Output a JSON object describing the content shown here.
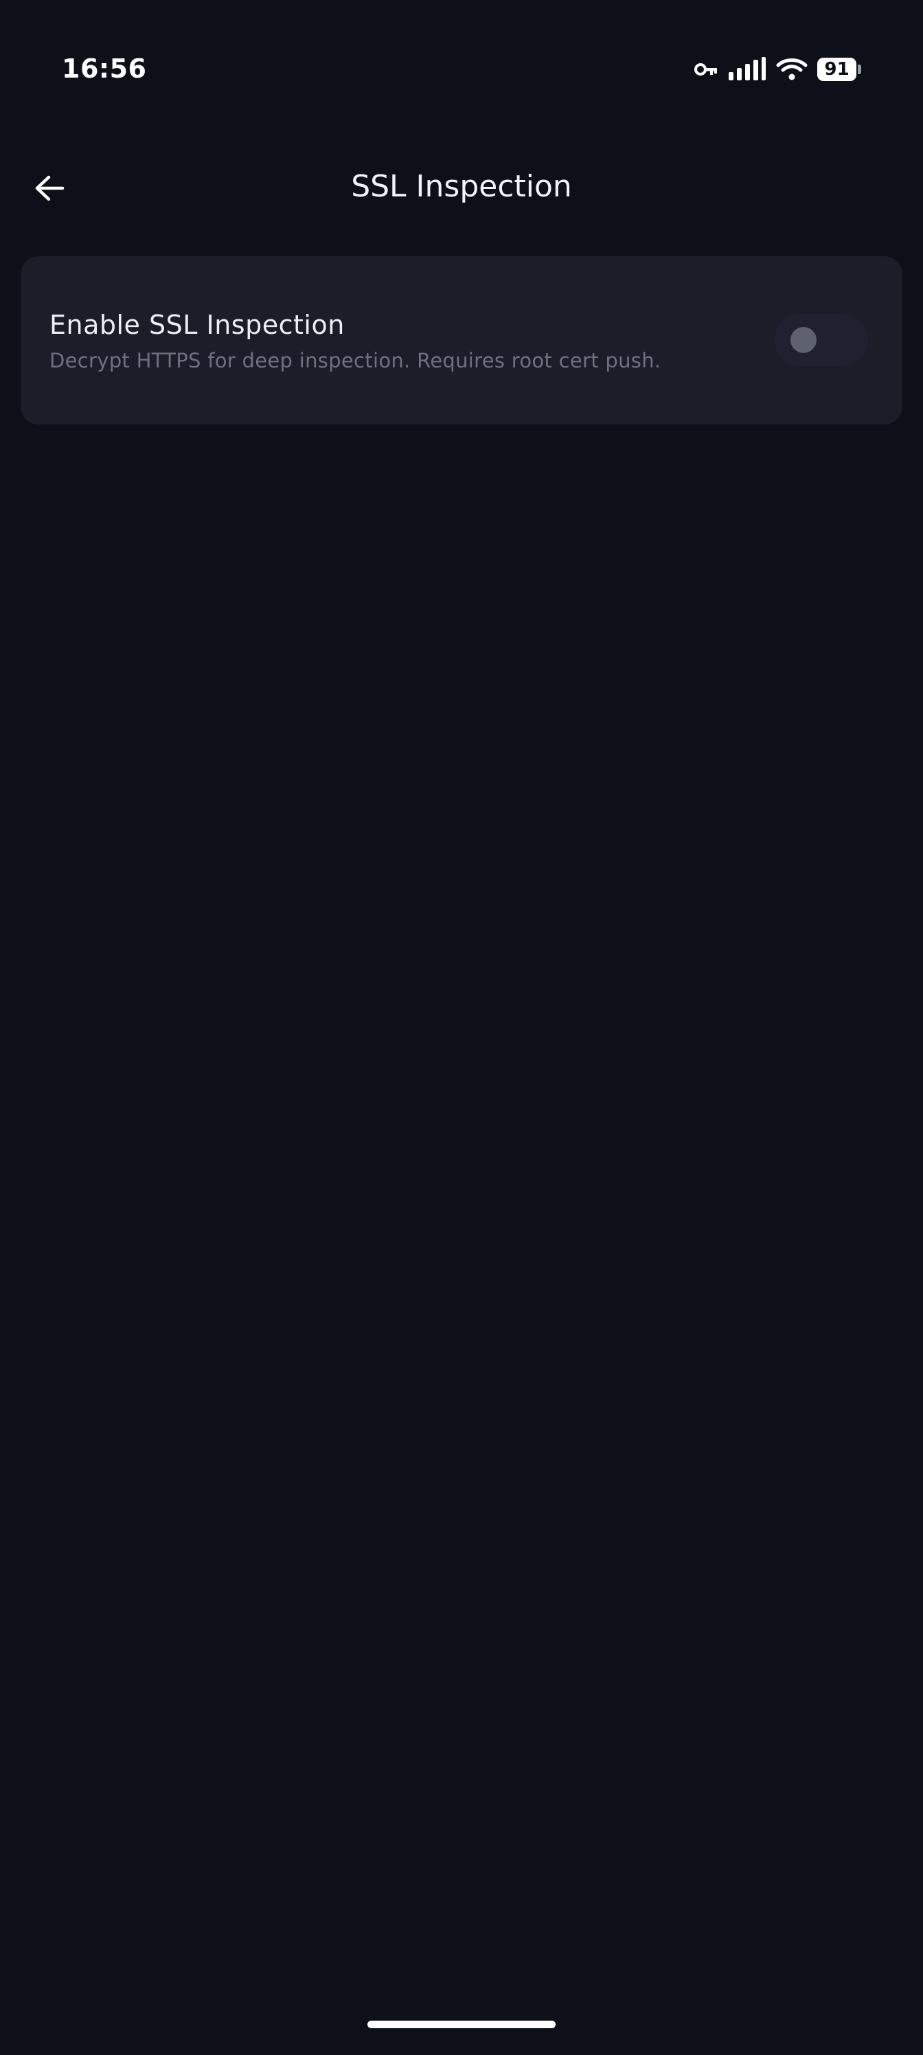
{
  "status_bar": {
    "time": "16:56",
    "battery_level": "91",
    "icons": [
      "vpn-key-icon",
      "signal-icon",
      "wifi-icon",
      "battery-icon"
    ]
  },
  "app_bar": {
    "title": "SSL Inspection",
    "back_icon": "arrow-left-icon"
  },
  "settings": {
    "ssl_inspection": {
      "title": "Enable SSL Inspection",
      "description": "Decrypt HTTPS for deep inspection. Requires root cert push.",
      "enabled": false
    }
  },
  "colors": {
    "background": "#0d1018",
    "card": "#1b1d29",
    "title_text": "#f2f3f7",
    "description_text": "#6d7080",
    "toggle_track": "#1f2130",
    "toggle_thumb": "#5e6170"
  }
}
